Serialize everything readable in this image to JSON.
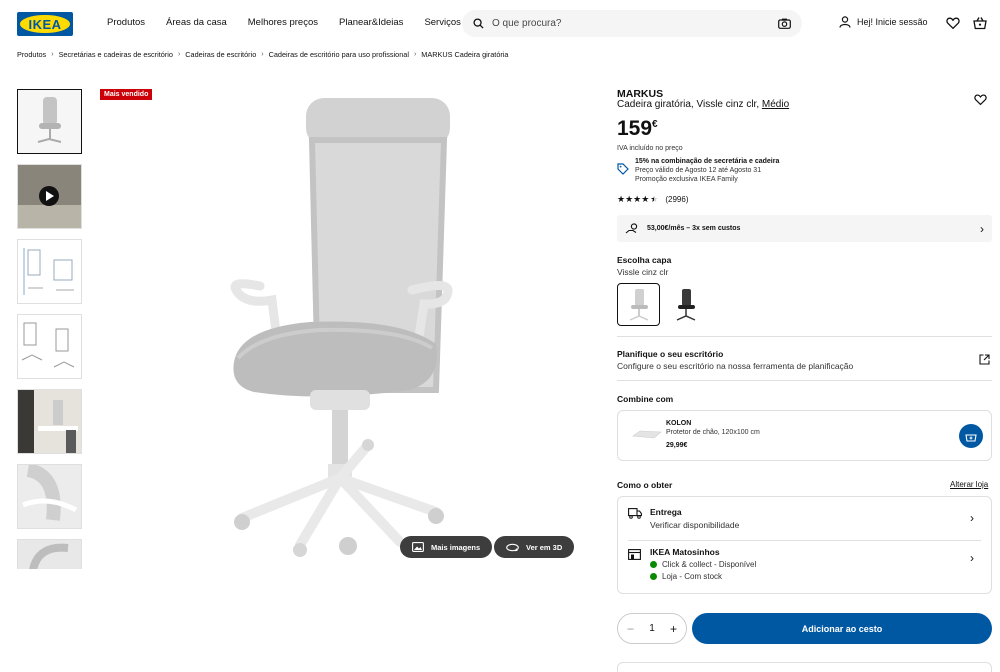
{
  "header": {
    "logo_text": "IKEA",
    "nav": [
      "Produtos",
      "Áreas da casa",
      "Melhores preços",
      "Planear&Ideias",
      "Serviços"
    ],
    "search_placeholder": "O que procura?",
    "login_label": "Hej! Inicie sessão"
  },
  "breadcrumb": [
    "Produtos",
    "Secretárias e cadeiras de escritório",
    "Cadeiras de escritório",
    "Cadeiras de escritório para uso profissional",
    "MARKUS Cadeira giratória"
  ],
  "gallery": {
    "badge": "Mais vendido",
    "more_images_label": "Mais imagens",
    "view_3d_label": "Ver em 3D"
  },
  "product": {
    "name": "MARKUS",
    "description": "Cadeira giratória, Vissle cinz clr,",
    "size_link": "Médio",
    "price_int": "159",
    "price_currency": "€",
    "vat_note": "IVA incluído no preço",
    "promo_title": "15% na combinação de secretária e cadeira",
    "promo_line2": "Preço válido de Agosto 12 até Agosto 31",
    "promo_line3": "Promoção exclusiva IKEA Family",
    "rating": 4.5,
    "review_count": "(2996)",
    "finance_text": "53,00€/mês – 3x sem custos",
    "cover_label": "Escolha capa",
    "cover_value": "Vissle cinz clr",
    "planner_title": "Planifique o seu escritório",
    "planner_text": "Configure o seu escritório na nossa ferramenta de planificação",
    "combine_label": "Combine com",
    "combine_item": {
      "name": "KOLON",
      "desc": "Protetor de chão, 120x100 cm",
      "price": "29,99€"
    },
    "how_to_get_label": "Como o obter",
    "change_store_label": "Alterar loja",
    "delivery_title": "Entrega",
    "delivery_text": "Verificar disponibilidade",
    "store_title": "IKEA Matosinhos",
    "store_line1": "Click & collect - Disponível",
    "store_line2": "Loja - Com stock",
    "quantity": "1",
    "add_to_cart_label": "Adicionar ao cesto"
  },
  "colors": {
    "brand_blue": "#0058a3",
    "brand_yellow": "#ffdb00",
    "badge_red": "#cc0008",
    "stock_green": "#0a8a00"
  },
  "icons": [
    "search-icon",
    "camera-icon",
    "user-icon",
    "heart-icon",
    "basket-icon",
    "play-icon",
    "images-icon",
    "rotate-3d-icon",
    "tag-icon",
    "star-icon",
    "hand-coin-icon",
    "chevron-right-icon",
    "external-link-icon",
    "add-to-cart-icon",
    "truck-icon",
    "store-icon",
    "minus-icon",
    "plus-icon"
  ]
}
